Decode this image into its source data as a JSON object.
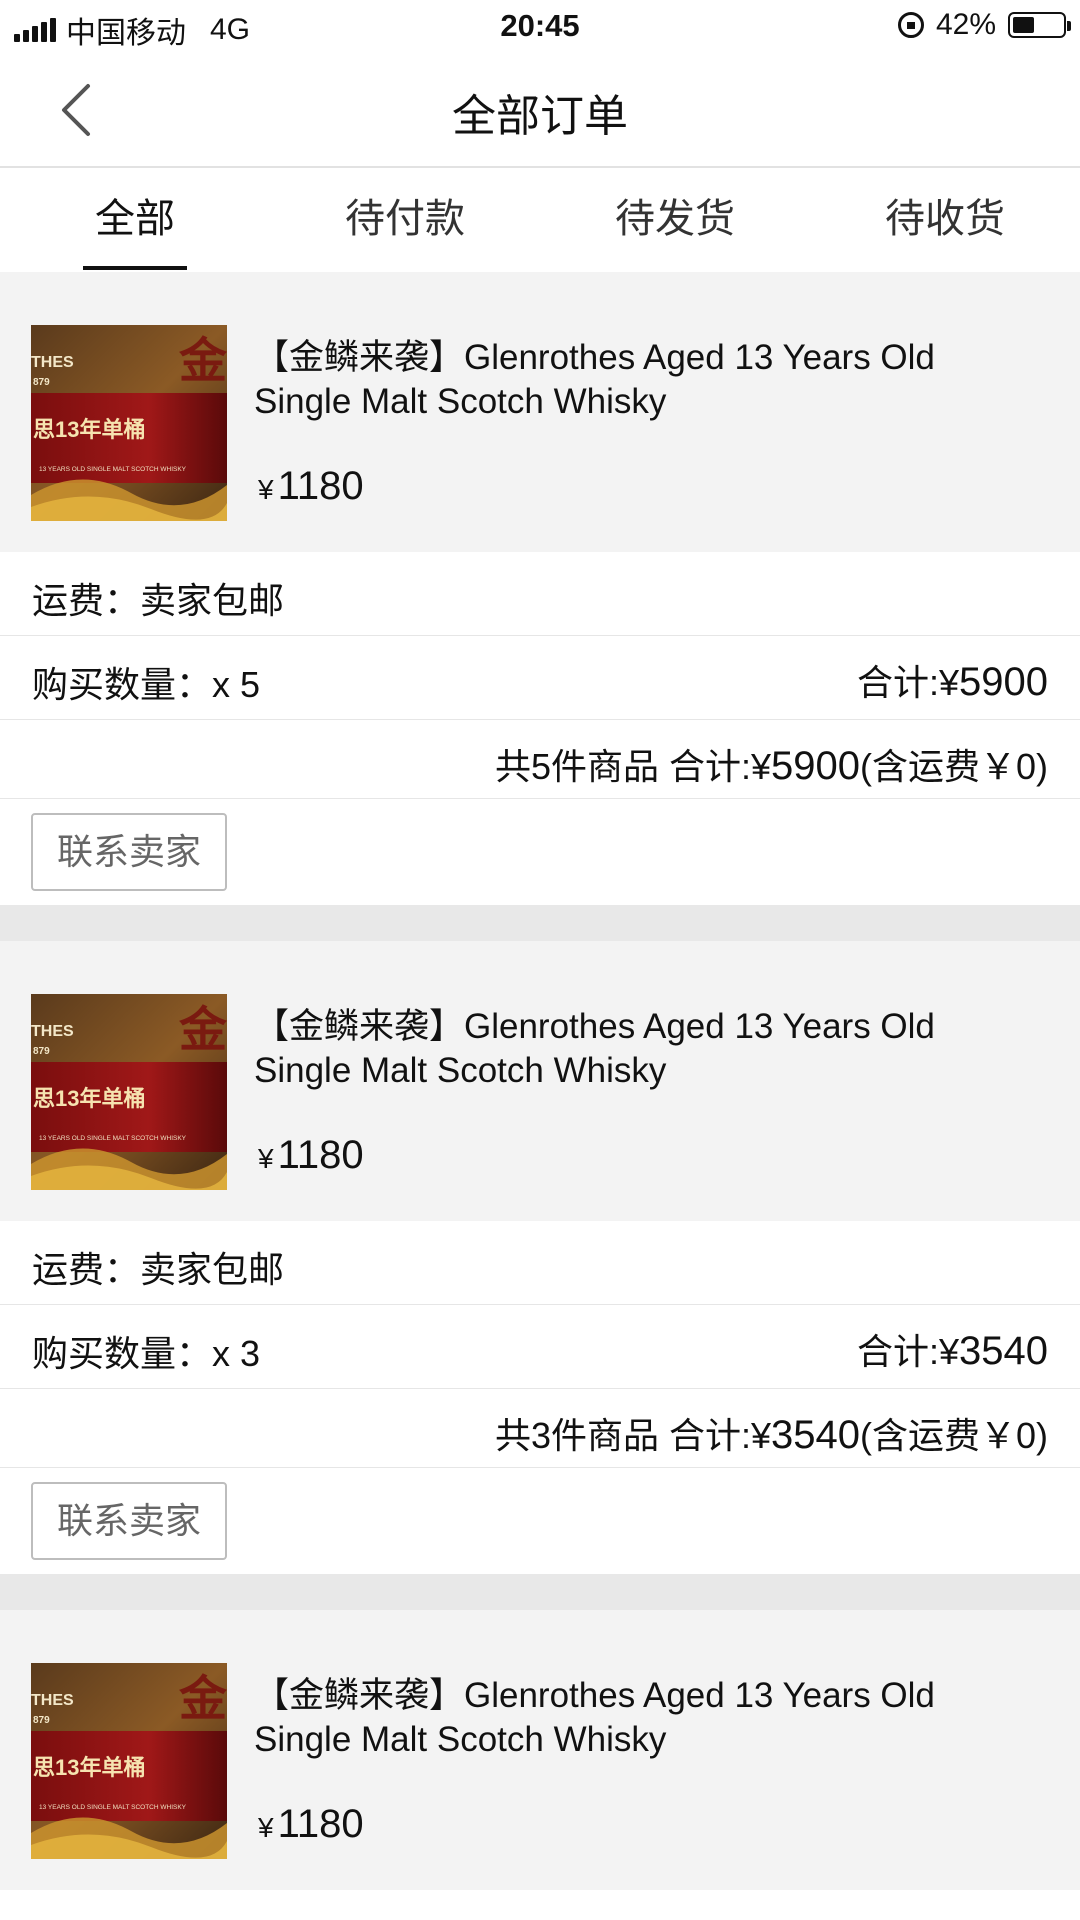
{
  "status_bar": {
    "carrier": "中国移动",
    "network": "4G",
    "time": "20:45",
    "battery": "42%",
    "battery_level": 0.42
  },
  "nav": {
    "title": "全部订单"
  },
  "tabs": [
    {
      "label": "全部",
      "active": true
    },
    {
      "label": "待付款",
      "active": false
    },
    {
      "label": "待发货",
      "active": false
    },
    {
      "label": "待收货",
      "active": false
    }
  ],
  "orders": [
    {
      "product_title": "【金鳞来袭】Glenrothes Aged 13 Years Old Single Malt Scotch Whisky",
      "price_symbol": "¥",
      "price": "1180",
      "shipping_label": "运费：",
      "shipping_value": "卖家包邮",
      "qty_label": "购买数量：",
      "qty_value": "x 5",
      "total_label": "合计:",
      "total_symbol": "¥",
      "total_value": "5900",
      "summary_prefix": "共5件商品 合计:",
      "summary_symbol": "¥",
      "summary_value": "5900",
      "summary_suffix": "(含运费￥0)",
      "contact_label": "联系卖家"
    },
    {
      "product_title": "【金鳞来袭】Glenrothes Aged 13 Years Old Single Malt Scotch Whisky",
      "price_symbol": "¥",
      "price": "1180",
      "shipping_label": "运费：",
      "shipping_value": "卖家包邮",
      "qty_label": "购买数量：",
      "qty_value": "x 3",
      "total_label": "合计:",
      "total_symbol": "¥",
      "total_value": "3540",
      "summary_prefix": "共3件商品 合计:",
      "summary_symbol": "¥",
      "summary_value": "3540",
      "summary_suffix": "(含运费￥0)",
      "contact_label": "联系卖家"
    },
    {
      "product_title": "【金鳞来袭】Glenrothes Aged 13 Years Old Single Malt Scotch Whisky",
      "price_symbol": "¥",
      "price": "1180"
    }
  ],
  "thumbnail": {
    "brand_text": "THES",
    "year_text": "879",
    "cn_label": "思13年单桶",
    "en_label": "13 YEARS OLD SINGLE MALT SCOTCH WHISKY",
    "side_char": "金"
  },
  "colors": {
    "tab_underline": "#111111",
    "product_bg": "#f3f3f3",
    "separator_bg": "#e8e8e8"
  }
}
